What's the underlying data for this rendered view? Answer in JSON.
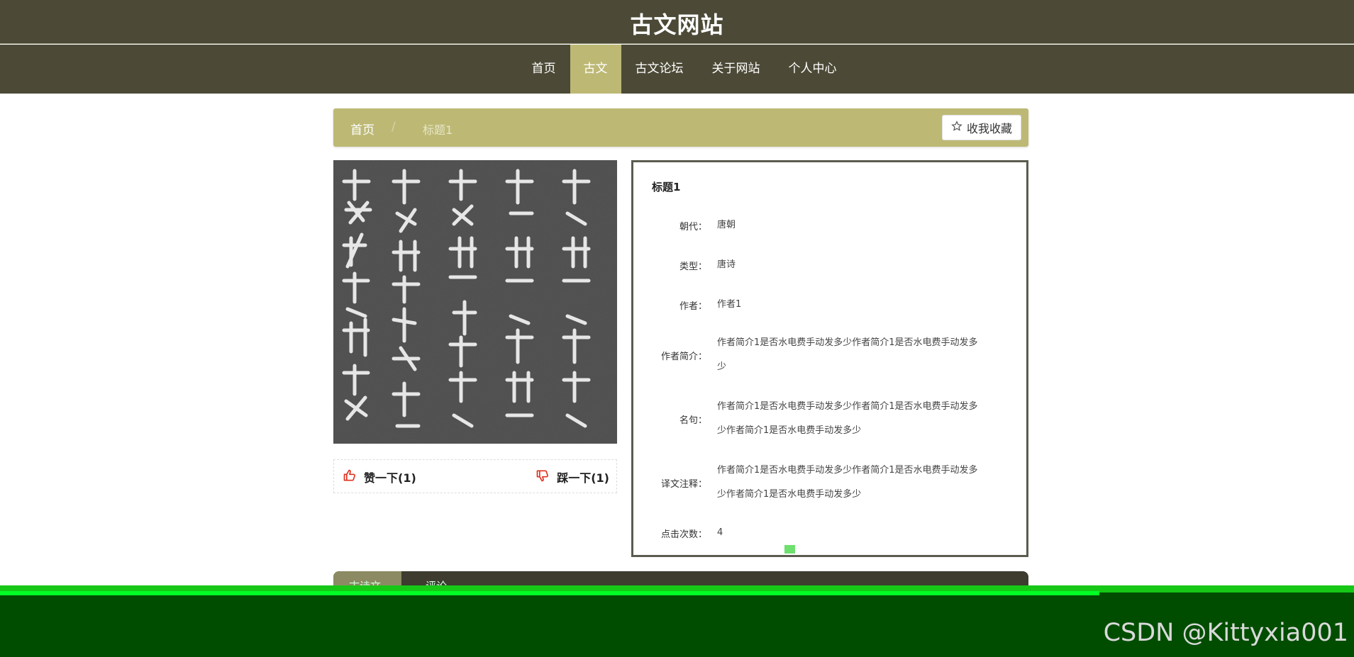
{
  "header": {
    "title": "古文网站"
  },
  "nav": {
    "items": [
      {
        "label": "首页"
      },
      {
        "label": "古文"
      },
      {
        "label": "古文论坛"
      },
      {
        "label": "关于网站"
      },
      {
        "label": "个人中心"
      }
    ],
    "active_index": 1
  },
  "breadcrumb": {
    "home": "首页",
    "separator": "/",
    "current": "标题1"
  },
  "favorite_button": {
    "label": "收我收藏",
    "icon": "star-outline-icon"
  },
  "votes": {
    "up_label": "赞一下(1)",
    "down_label": "踩一下(1)",
    "up_icon": "thumbs-up-icon",
    "down_icon": "thumbs-down-icon",
    "icon_color": "#e0311f"
  },
  "detail": {
    "title": "标题1",
    "fields": [
      {
        "label": "朝代：",
        "value": "唐朝"
      },
      {
        "label": "类型：",
        "value": "唐诗"
      },
      {
        "label": "作者：",
        "value": "作者1"
      },
      {
        "label": "作者简介：",
        "value": "作者简介1是否水电费手动发多少作者简介1是否水电费手动发多少"
      },
      {
        "label": "名句：",
        "value": "作者简介1是否水电费手动发多少作者简介1是否水电费手动发多少作者简介1是否水电费手动发多少"
      },
      {
        "label": "译文注释：",
        "value": "作者简介1是否水电费手动发多少作者简介1是否水电费手动发多少作者简介1是否水电费手动发多少"
      },
      {
        "label": "点击次数：",
        "value": "4"
      }
    ]
  },
  "bottom_tabs": [
    {
      "label": "古诗文"
    },
    {
      "label": "评论"
    }
  ],
  "watermark": "CSDN @Kittyxia001",
  "colors": {
    "header_bg": "#4c4a37",
    "accent": "#bdb975",
    "bottom_band": "#004d00"
  }
}
